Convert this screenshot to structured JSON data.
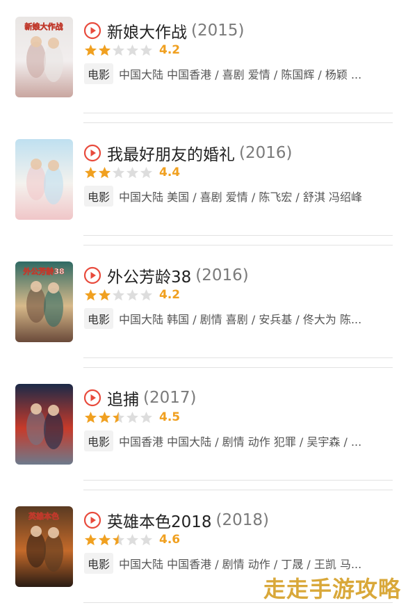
{
  "movies": [
    {
      "title": "新娘大作战",
      "year": "(2015)",
      "score": "4.2",
      "stars_full": 2,
      "stars_half": 0,
      "tag": "电影",
      "meta": "中国大陆 中国香港 / 喜剧 爱情 / 陈国辉 / 杨颖 ...",
      "poster_colors": [
        "#e9e6e4",
        "#f2eeee",
        "#c9a6a0"
      ],
      "poster_text": "新娘大作战"
    },
    {
      "title": "我最好朋友的婚礼",
      "year": "(2016)",
      "score": "4.4",
      "stars_full": 2,
      "stars_half": 0,
      "tag": "电影",
      "meta": "中国大陆 美国 / 喜剧 爱情 / 陈飞宏 / 舒淇 冯绍峰",
      "poster_colors": [
        "#bfe0f0",
        "#f4f2ee",
        "#f0c6c8"
      ],
      "poster_text": ""
    },
    {
      "title": "外公芳龄38",
      "year": "(2016)",
      "score": "4.2",
      "stars_full": 2,
      "stars_half": 0,
      "tag": "电影",
      "meta": "中国大陆 韩国 / 剧情 喜剧 / 安兵基 / 佟大为 陈...",
      "poster_colors": [
        "#2f6a64",
        "#d7b98a",
        "#6a4a3a"
      ],
      "poster_text": "外公芳龄38"
    },
    {
      "title": "追捕",
      "year": "(2017)",
      "score": "4.5",
      "stars_full": 2,
      "stars_half": 1,
      "tag": "电影",
      "meta": "中国香港 中国大陆 / 剧情 动作 犯罪 / 吴宇森 / ...",
      "poster_colors": [
        "#1b2a48",
        "#c73a2a",
        "#6d7a8c"
      ],
      "poster_text": ""
    },
    {
      "title": "英雄本色2018",
      "year": "(2018)",
      "score": "4.6",
      "stars_full": 2,
      "stars_half": 1,
      "tag": "电影",
      "meta": "中国大陆 中国香港 / 剧情 动作 / 丁晟 / 王凯 马...",
      "poster_colors": [
        "#5a3a22",
        "#c46a2a",
        "#2a1c14"
      ],
      "poster_text": "英雄本色"
    }
  ],
  "watermark": "走走手游攻略",
  "colors": {
    "accent": "#e84a3c",
    "star_on": "#f0a020",
    "star_off": "#dddddd"
  }
}
